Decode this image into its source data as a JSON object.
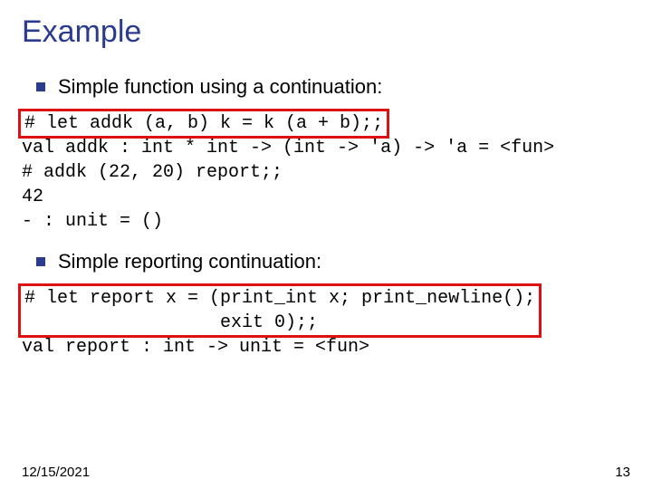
{
  "title": "Example",
  "bullet1": "Simple function using a continuation:",
  "code1_hl": "# let addk (a, b) k = k (a + b);;",
  "code1_rest": "val addk : int * int -> (int -> 'a) -> 'a = <fun>\n# addk (22, 20) report;;\n42\n- : unit = ()",
  "bullet2": "Simple reporting continuation:",
  "code2_hl": "# let report x = (print_int x; print_newline();\n                  exit 0);;",
  "code2_rest": "val report : int -> unit = <fun>",
  "footer_date": "12/15/2021",
  "footer_page": "13"
}
